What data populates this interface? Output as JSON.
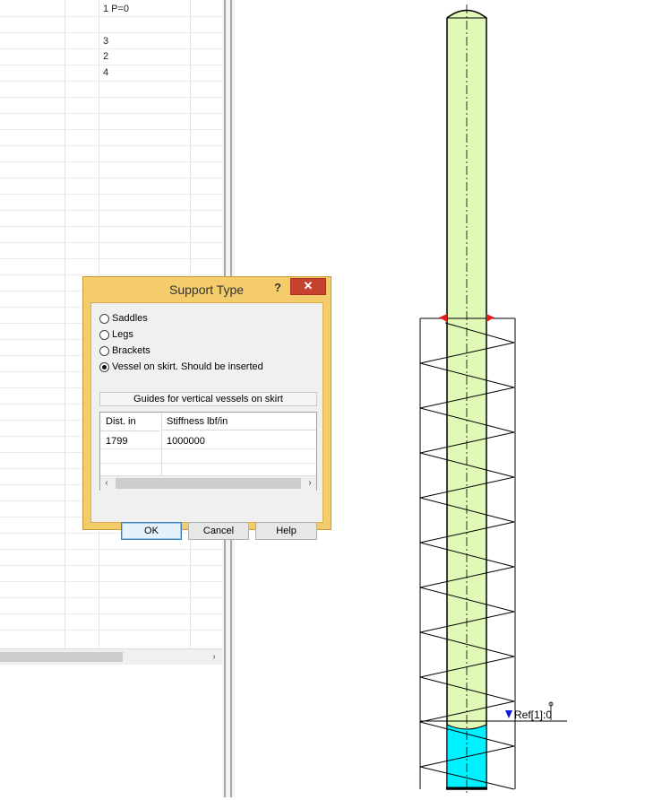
{
  "grid": {
    "cells": [
      {
        "row": 0,
        "text": "1 P=0"
      },
      {
        "row": 2,
        "text": "3"
      },
      {
        "row": 3,
        "text": "2"
      },
      {
        "row": 4,
        "text": "4"
      }
    ],
    "scroll_right_arrow": "›"
  },
  "dialog": {
    "title": "Support Type",
    "help_glyph": "?",
    "close_glyph": "✕",
    "options": [
      {
        "label": "Saddles",
        "checked": false
      },
      {
        "label": "Legs",
        "checked": false
      },
      {
        "label": "Brackets",
        "checked": false
      },
      {
        "label": "Vessel on skirt. Should be inserted",
        "checked": true
      }
    ],
    "guides_header": "Guides for vertical vessels on skirt",
    "table": {
      "columns": [
        "Dist. in",
        "Stiffness lbf/in"
      ],
      "rows": [
        [
          "1799",
          "1000000"
        ]
      ],
      "scroll_left": "‹",
      "scroll_right": "›"
    },
    "buttons": {
      "ok": "OK",
      "cancel": "Cancel",
      "help": "Help"
    }
  },
  "drawing": {
    "ref_label": "Ref[1]:0",
    "colors": {
      "vessel": "#e1f9b6",
      "base": "#00f1ff",
      "marker": "#e02020",
      "ref_marker": "#1515e0"
    }
  }
}
